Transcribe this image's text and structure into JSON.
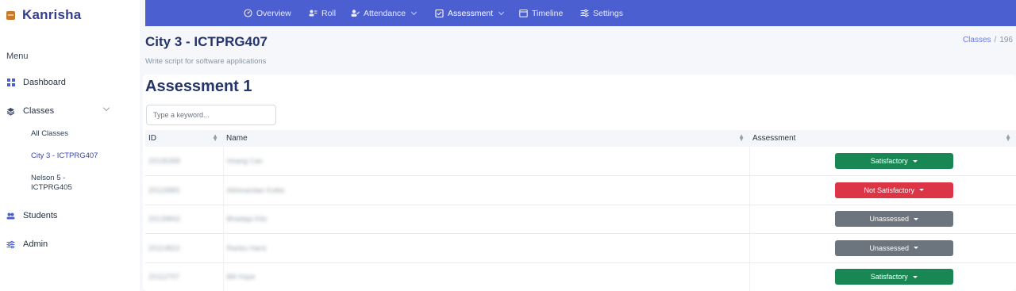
{
  "brand": {
    "name": "Kanrisha"
  },
  "sidebar": {
    "menu_label": "Menu",
    "items": [
      {
        "label": "Dashboard",
        "icon": "grid-icon"
      },
      {
        "label": "Classes",
        "icon": "layers-icon"
      },
      {
        "label": "Students",
        "icon": "users-icon"
      },
      {
        "label": "Admin",
        "icon": "sliders-icon"
      }
    ],
    "class_sub": [
      {
        "label": "All Classes"
      },
      {
        "label": "City 3 - ICTPRG407"
      },
      {
        "label": "Nelson 5 -",
        "label2": "ICTPRG405"
      }
    ]
  },
  "topnav": {
    "tabs": [
      {
        "label": "Overview",
        "icon": "dashboard-icon"
      },
      {
        "label": "Roll",
        "icon": "users-icon"
      },
      {
        "label": "Attendance",
        "icon": "user-check-icon"
      },
      {
        "label": "Assessment",
        "icon": "clipboard-icon"
      },
      {
        "label": "Timeline",
        "icon": "calendar-icon"
      },
      {
        "label": "Settings",
        "icon": "sliders-icon"
      }
    ]
  },
  "header": {
    "title": "City 3 - ICTPRG407",
    "subtitle": "Write script for software applications",
    "breadcrumb": {
      "link": "Classes",
      "current": "196"
    }
  },
  "assessment": {
    "title": "Assessment 1",
    "search_placeholder": "Type a keyword...",
    "columns": {
      "id": "ID",
      "name": "Name",
      "assessment": "Assessment"
    },
    "rows": [
      {
        "id": "20135358",
        "name": "Hoang Can",
        "status": "Satisfactory",
        "color": "#198754"
      },
      {
        "id": "20115883",
        "name": "Abhinandan Koike",
        "status": "Not Satisfactory",
        "color": "#dc3545"
      },
      {
        "id": "20139842",
        "name": "Bhadaja Kito",
        "status": "Unassessed",
        "color": "#6c757d"
      },
      {
        "id": "20114823",
        "name": "Ranbu Harsi",
        "status": "Unassessed",
        "color": "#6c757d"
      },
      {
        "id": "20112707",
        "name": "Bill Hope",
        "status": "Satisfactory",
        "color": "#198754"
      }
    ]
  }
}
